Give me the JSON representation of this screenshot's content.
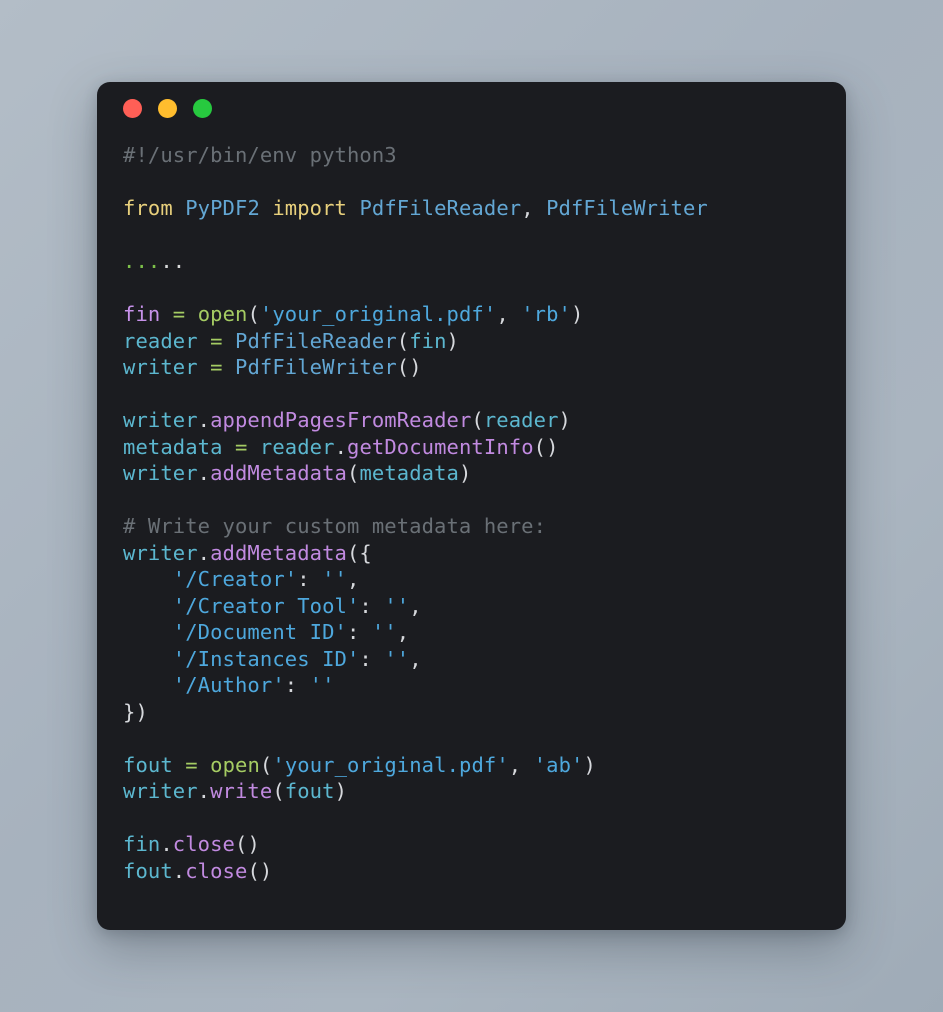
{
  "window": {
    "name": "code-snippet-window",
    "background_color": "#1b1c20",
    "page_background_color": "#aab5c0",
    "traffic_lights": [
      {
        "name": "close-button",
        "label": "Close",
        "color": "#ff5f56"
      },
      {
        "name": "minimize-button",
        "label": "Minimize",
        "color": "#ffbd2e"
      },
      {
        "name": "maximize-button",
        "label": "Maximize",
        "color": "#27c93f"
      }
    ]
  },
  "theme": {
    "comment": "#6a7076",
    "keyword": "#e8d07c",
    "class_name": "#63a7d4",
    "string": "#4ea8dd",
    "variable": "#5cb7cf",
    "special_variable": "#c792ea",
    "method": "#c18ae0",
    "function": "#a5cc63",
    "operator": "#a5cc63",
    "punctuation": "#d6d8dc"
  },
  "code": {
    "language": "python",
    "full_text": "#!/usr/bin/env python3\n\nfrom PyPDF2 import PdfFileReader, PdfFileWriter\n\n.....\n\nfin = open('your_original.pdf', 'rb')\nreader = PdfFileReader(fin)\nwriter = PdfFileWriter()\n\nwriter.appendPagesFromReader(reader)\nmetadata = reader.getDocumentInfo()\nwriter.addMetadata(metadata)\n\n# Write your custom metadata here:\nwriter.addMetadata({\n    '/Creator': '',\n    '/Creator Tool': '',\n    '/Document ID': '',\n    '/Instances ID': '',\n    '/Author': ''\n})\n\nfout = open('your_original.pdf', 'ab')\nwriter.write(fout)\n\nfin.close()\nfout.close()",
    "lines": [
      {
        "n": 1,
        "text": "#!/usr/bin/env python3"
      },
      {
        "n": 2,
        "text": ""
      },
      {
        "n": 3,
        "text": "from PyPDF2 import PdfFileReader, PdfFileWriter"
      },
      {
        "n": 4,
        "text": ""
      },
      {
        "n": 5,
        "text": "....."
      },
      {
        "n": 6,
        "text": ""
      },
      {
        "n": 7,
        "text": "fin = open('your_original.pdf', 'rb')"
      },
      {
        "n": 8,
        "text": "reader = PdfFileReader(fin)"
      },
      {
        "n": 9,
        "text": "writer = PdfFileWriter()"
      },
      {
        "n": 10,
        "text": ""
      },
      {
        "n": 11,
        "text": "writer.appendPagesFromReader(reader)"
      },
      {
        "n": 12,
        "text": "metadata = reader.getDocumentInfo()"
      },
      {
        "n": 13,
        "text": "writer.addMetadata(metadata)"
      },
      {
        "n": 14,
        "text": ""
      },
      {
        "n": 15,
        "text": "# Write your custom metadata here:"
      },
      {
        "n": 16,
        "text": "writer.addMetadata({"
      },
      {
        "n": 17,
        "text": "    '/Creator': '',"
      },
      {
        "n": 18,
        "text": "    '/Creator Tool': '',"
      },
      {
        "n": 19,
        "text": "    '/Document ID': '',"
      },
      {
        "n": 20,
        "text": "    '/Instances ID': '',"
      },
      {
        "n": 21,
        "text": "    '/Author': ''"
      },
      {
        "n": 22,
        "text": "})"
      },
      {
        "n": 23,
        "text": ""
      },
      {
        "n": 24,
        "text": "fout = open('your_original.pdf', 'ab')"
      },
      {
        "n": 25,
        "text": "writer.write(fout)"
      },
      {
        "n": 26,
        "text": ""
      },
      {
        "n": 27,
        "text": "fin.close()"
      },
      {
        "n": 28,
        "text": "fout.close()"
      }
    ],
    "tokens": {
      "shebang": "#!/usr/bin/env python3",
      "kw_from": "from",
      "mod_pypdf2": "PyPDF2",
      "kw_import": "import",
      "cls_reader": "PdfFileReader",
      "cls_writer": "PdfFileWriter",
      "ellipsis": ".....",
      "var_fin": "fin",
      "var_fout": "fout",
      "var_reader": "reader",
      "var_writer": "writer",
      "var_metadata": "metadata",
      "fn_open": "open",
      "str_path": "'your_original.pdf'",
      "str_rb": "'rb'",
      "str_ab": "'ab'",
      "m_appendPagesFromReader": "appendPagesFromReader",
      "m_getDocumentInfo": "getDocumentInfo",
      "m_addMetadata": "addMetadata",
      "m_write": "write",
      "m_close": "close",
      "comment_custom": "# Write your custom metadata here:",
      "key_creator": "'/Creator'",
      "key_creator_tool": "'/Creator Tool'",
      "key_document_id": "'/Document ID'",
      "key_instances_id": "'/Instances ID'",
      "key_author": "'/Author'",
      "empty_string": "''"
    }
  }
}
